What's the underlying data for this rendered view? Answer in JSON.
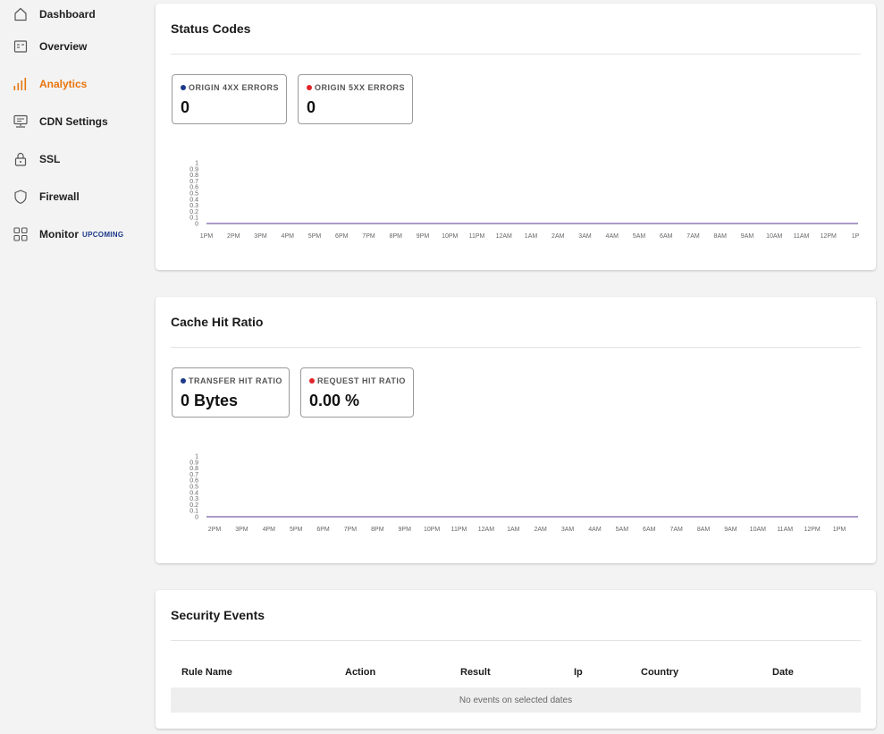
{
  "sidebar": {
    "items": [
      {
        "label": "Dashboard",
        "icon": "home-icon"
      },
      {
        "label": "Overview",
        "icon": "overview-icon"
      },
      {
        "label": "Analytics",
        "icon": "analytics-bars-icon",
        "active": true
      },
      {
        "label": "CDN Settings",
        "icon": "cdn-settings-icon"
      },
      {
        "label": "SSL",
        "icon": "lock-icon"
      },
      {
        "label": "Firewall",
        "icon": "shield-icon"
      },
      {
        "label": "Monitor",
        "icon": "grid-icon",
        "badge": "UPCOMING"
      }
    ]
  },
  "colors": {
    "accent": "#e8740c",
    "series_blue": "#1d3a8a",
    "series_red": "#e0262b",
    "line": "#7b5ea8"
  },
  "status_codes": {
    "title": "Status Codes",
    "stats": [
      {
        "label": "ORIGIN 4XX ERRORS",
        "value": "0",
        "color": "#1d3a8a"
      },
      {
        "label": "ORIGIN 5XX ERRORS",
        "value": "0",
        "color": "#e0262b"
      }
    ]
  },
  "cache_hit_ratio": {
    "title": "Cache Hit Ratio",
    "stats": [
      {
        "label": "TRANSFER HIT RATIO",
        "value": "0 Bytes",
        "color": "#1d3a8a"
      },
      {
        "label": "REQUEST HIT RATIO",
        "value": "0.00 %",
        "color": "#e0262b"
      }
    ]
  },
  "security_events": {
    "title": "Security Events",
    "columns": [
      "Rule Name",
      "Action",
      "Result",
      "Ip",
      "Country",
      "Date"
    ],
    "empty_text": "No events on selected dates"
  },
  "chart_data": [
    {
      "type": "line",
      "x": [
        "1PM",
        "2PM",
        "3PM",
        "4PM",
        "5PM",
        "6PM",
        "7PM",
        "8PM",
        "9PM",
        "10PM",
        "11PM",
        "12AM",
        "1AM",
        "2AM",
        "3AM",
        "4AM",
        "5AM",
        "6AM",
        "7AM",
        "8AM",
        "9AM",
        "10AM",
        "11AM",
        "12PM",
        "1P"
      ],
      "yticks": [
        "0",
        "0.1",
        "0.2",
        "0.3",
        "0.4",
        "0.5",
        "0.6",
        "0.7",
        "0.8",
        "0.9",
        "1"
      ],
      "ylim": [
        0,
        1
      ],
      "series": [
        {
          "values": [
            0,
            0,
            0,
            0,
            0,
            0,
            0,
            0,
            0,
            0,
            0,
            0,
            0,
            0,
            0,
            0,
            0,
            0,
            0,
            0,
            0,
            0,
            0,
            0,
            0
          ]
        }
      ]
    },
    {
      "type": "line",
      "x": [
        "2PM",
        "3PM",
        "4PM",
        "5PM",
        "6PM",
        "7PM",
        "8PM",
        "9PM",
        "10PM",
        "11PM",
        "12AM",
        "1AM",
        "2AM",
        "3AM",
        "4AM",
        "5AM",
        "6AM",
        "7AM",
        "8AM",
        "9AM",
        "10AM",
        "11AM",
        "12PM",
        "1PM"
      ],
      "yticks": [
        "0",
        "0.1",
        "0.2",
        "0.3",
        "0.4",
        "0.5",
        "0.6",
        "0.7",
        "0.8",
        "0.9",
        "1"
      ],
      "ylim": [
        0,
        1
      ],
      "series": [
        {
          "values": [
            0,
            0,
            0,
            0,
            0,
            0,
            0,
            0,
            0,
            0,
            0,
            0,
            0,
            0,
            0,
            0,
            0,
            0,
            0,
            0,
            0,
            0,
            0,
            0
          ]
        }
      ]
    }
  ]
}
